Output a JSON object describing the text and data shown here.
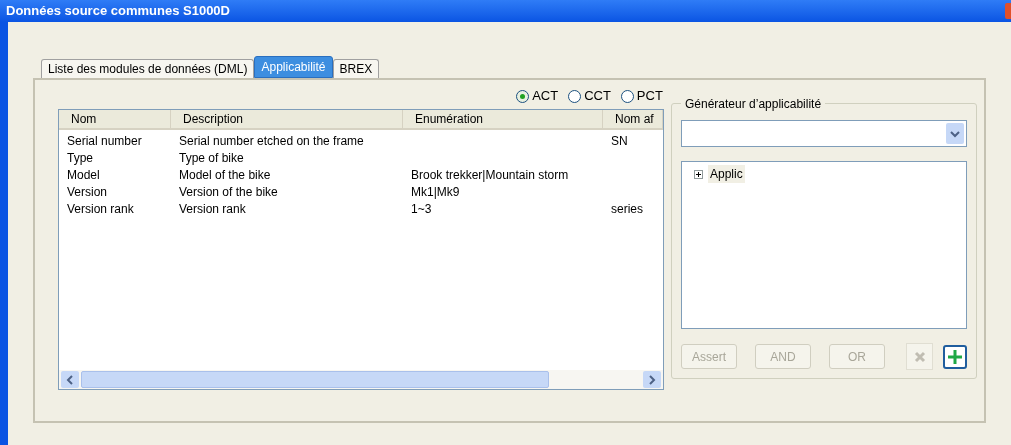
{
  "window": {
    "title": "Données source communes S1000D"
  },
  "tabs": [
    {
      "label": "Liste des modules de données (DML)",
      "selected": false
    },
    {
      "label": "Applicabilité",
      "selected": true
    },
    {
      "label": "BREX",
      "selected": false
    }
  ],
  "radios": [
    {
      "label": "ACT",
      "selected": true
    },
    {
      "label": "CCT",
      "selected": false
    },
    {
      "label": "PCT",
      "selected": false
    }
  ],
  "table": {
    "columns": [
      "Nom",
      "Description",
      "Enumération",
      "Nom af"
    ],
    "rows": [
      [
        "Serial number",
        "Serial number etched on the frame",
        "",
        "SN"
      ],
      [
        "Type",
        "Type of bike",
        "",
        ""
      ],
      [
        "Model",
        "Model of the bike",
        "Brook trekker|Mountain storm",
        ""
      ],
      [
        "Version",
        "Version of the bike",
        "Mk1|Mk9",
        ""
      ],
      [
        "Version rank",
        "Version rank",
        "1~3",
        "series"
      ]
    ]
  },
  "generator": {
    "title": "Générateur d’applicabilité",
    "tree": [
      {
        "label": "Applic",
        "expanded": false
      }
    ],
    "buttons": [
      {
        "label": "Assert",
        "disabled": true
      },
      {
        "label": "AND",
        "disabled": true
      },
      {
        "label": "OR",
        "disabled": true
      }
    ],
    "delete": {
      "disabled": true
    },
    "add": {
      "disabled": false
    }
  }
}
